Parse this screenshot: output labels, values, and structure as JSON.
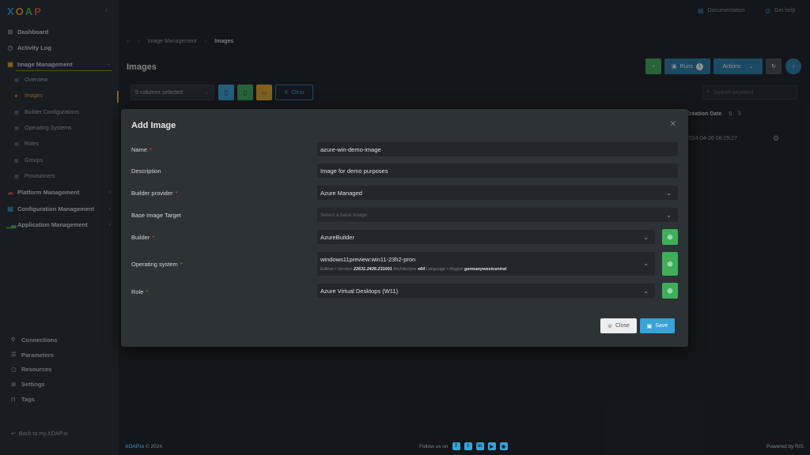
{
  "app": {
    "logo": "XOAP"
  },
  "sidebar": {
    "items": [
      {
        "label": "Dashboard",
        "icon": "dashboard-icon"
      },
      {
        "label": "Activity Log",
        "icon": "clock-icon"
      },
      {
        "label": "Image Management",
        "icon": "image-icon"
      },
      {
        "label": "Platform Management",
        "icon": "cloud-icon"
      },
      {
        "label": "Configuration Management",
        "icon": "config-icon"
      },
      {
        "label": "Application Management",
        "icon": "chart-icon"
      }
    ],
    "sub_items": [
      {
        "label": "Overview"
      },
      {
        "label": "Images",
        "active": true
      },
      {
        "label": "Builder Configurations"
      },
      {
        "label": "Operating Systems"
      },
      {
        "label": "Roles"
      },
      {
        "label": "Groups"
      },
      {
        "label": "Provisioners"
      }
    ],
    "bottom": [
      {
        "label": "Connections"
      },
      {
        "label": "Parameters"
      },
      {
        "label": "Resources"
      },
      {
        "label": "Settings"
      },
      {
        "label": "Tags"
      }
    ],
    "back": "Back to my.XOAP.io"
  },
  "topbar": {
    "documentation": "Documentation",
    "help": "Get help"
  },
  "breadcrumb": {
    "section": "Image Management",
    "current": "Images"
  },
  "page": {
    "title": "Images",
    "runs_label": "Runs",
    "runs_count": "1",
    "actions_label": "Actions"
  },
  "toolbar": {
    "columns": "9 columns selected",
    "clear": "Clear",
    "search_placeholder": "Search keyword"
  },
  "table": {
    "creation_header": "Creation Date",
    "creation_value": "2024-04-26 08:29:27"
  },
  "modal": {
    "title": "Add Image",
    "fields": {
      "name_label": "Name",
      "name_value": "azure-win-demo-image",
      "description_label": "Description",
      "description_value": "Image for demo purposes",
      "provider_label": "Builder provider",
      "provider_value": "Azure Managed",
      "base_label": "Base Image Target",
      "base_placeholder": "Select a base image",
      "builder_label": "Builder",
      "builder_value": "AzureBuilder",
      "os_label": "Operating system",
      "os_value": "windows11preview:win11-23h2-pron",
      "os_edition_label": "Edition",
      "os_version_label": "Version",
      "os_version": "22631.2428.231001",
      "os_arch_label": "Architecture",
      "os_arch": "x64",
      "os_lang_label": "Language",
      "os_region_label": "Region",
      "os_region": "germanywestcentral",
      "role_label": "Role",
      "role_value": "Azure Virtual Desktops (W11)"
    },
    "close_label": "Close",
    "save_label": "Save"
  },
  "footer": {
    "brand": "XOAP.io",
    "copyright": "© 2024",
    "follow": "Follow us on",
    "powered": "Powered by RIS"
  },
  "colors": {
    "accent": "#37a3d6",
    "success": "#3fae5b",
    "warning": "#e4a82c",
    "danger": "#d9534f"
  }
}
